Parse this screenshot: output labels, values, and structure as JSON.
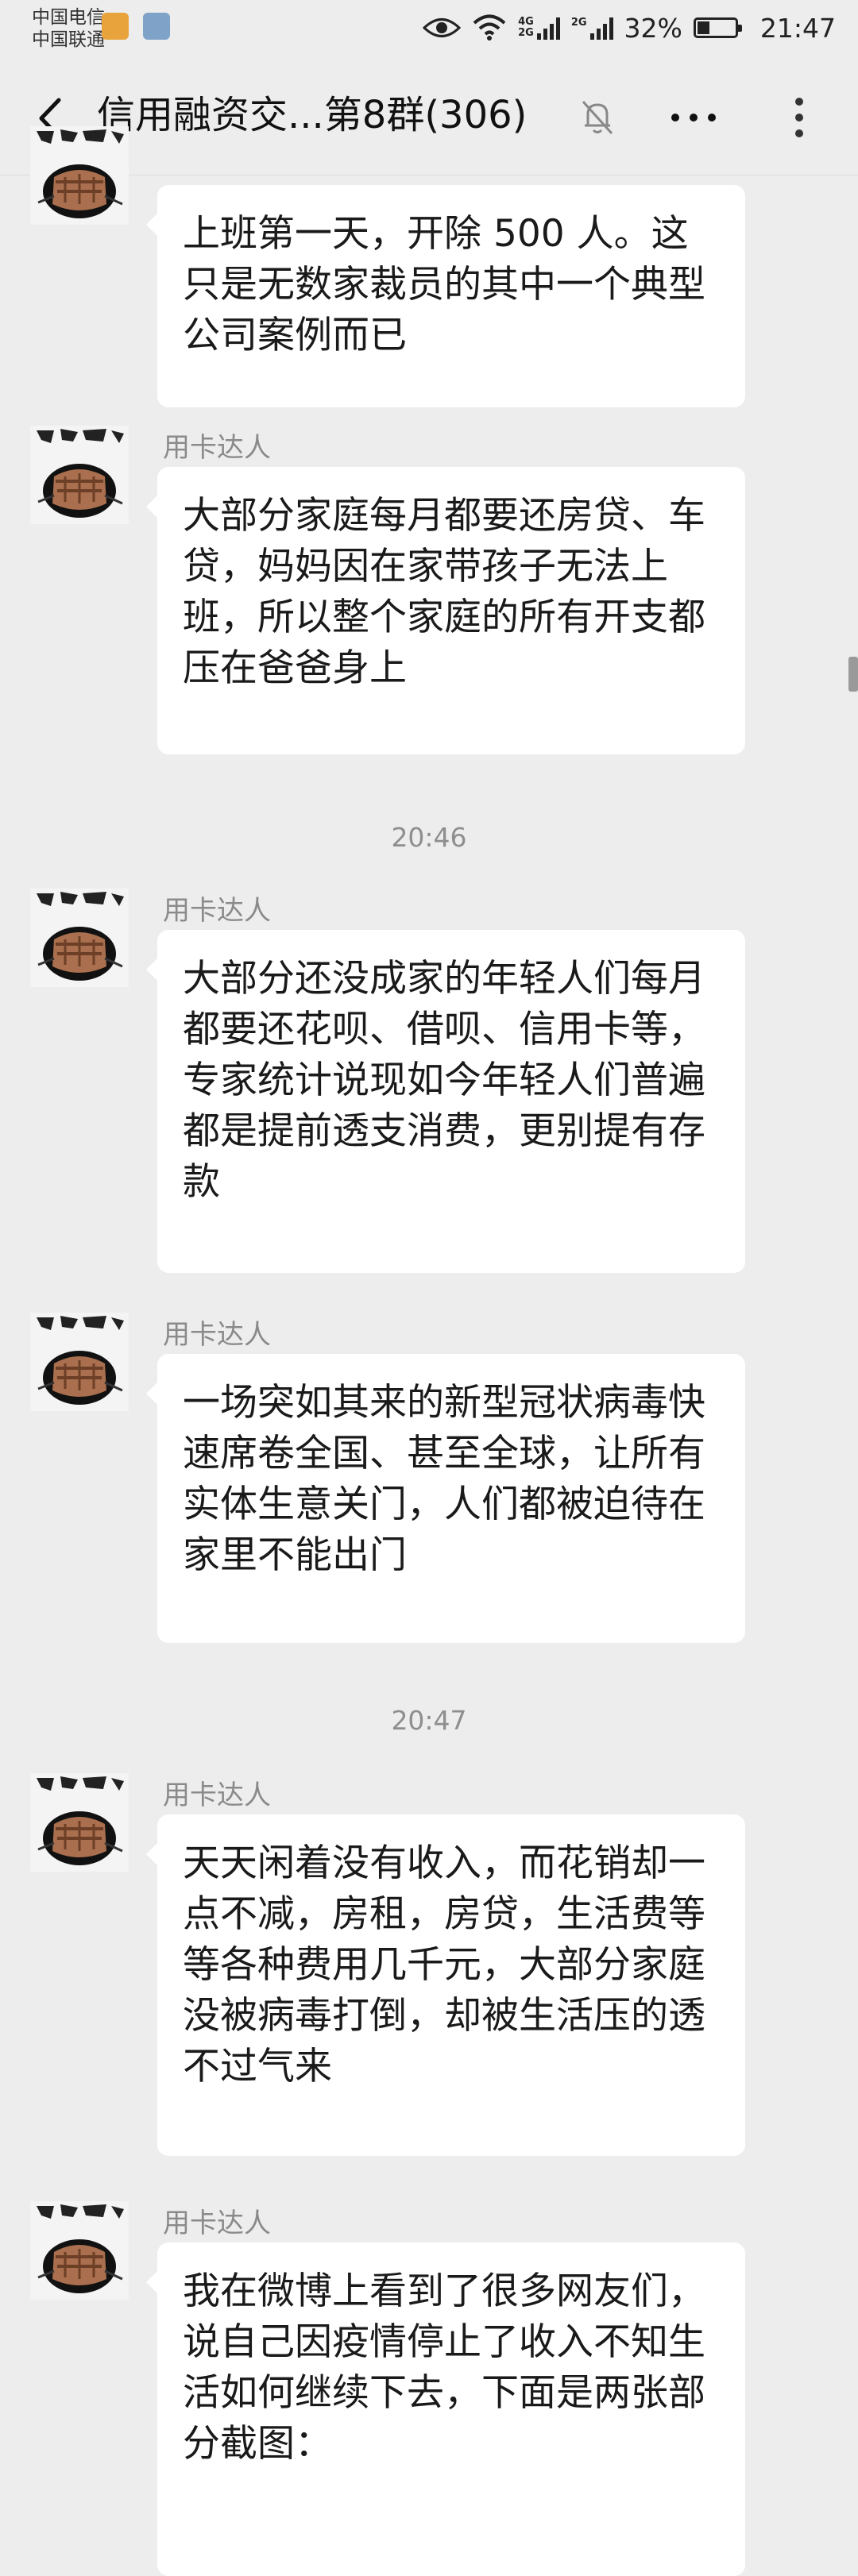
{
  "status_bar": {
    "carrier_1": "中国电信",
    "carrier_2": "中国联通",
    "net_1_top": "4G",
    "net_1_bottom": "2G",
    "net_2": "2G",
    "battery_text": "32%",
    "battery_level": 0.32,
    "time": "21:47"
  },
  "nav": {
    "title": "信用融资交...第8群(306)"
  },
  "colors": {
    "background": "#ededed",
    "bubble": "#ffffff",
    "text": "#1a1a1a",
    "meta_text": "#8a8a8a"
  },
  "messages": [
    {
      "sender": "",
      "text": "上班第一天，开除 500 人。这只是无数家裁员的其中一个典型公司案例而已"
    },
    {
      "sender": "用卡达人",
      "text": "大部分家庭每月都要还房贷、车贷，妈妈因在家带孩子无法上班，所以整个家庭的所有开支都压在爸爸身上"
    },
    {
      "time": "20:46"
    },
    {
      "sender": "用卡达人",
      "text": "大部分还没成家的年轻人们每月都要还花呗、借呗、信用卡等，专家统计说现如今年轻人们普遍都是提前透支消费，更别提有存款"
    },
    {
      "sender": "用卡达人",
      "text": "一场突如其来的新型冠状病毒快速席卷全国、甚至全球，让所有实体生意关门，人们都被迫待在家里不能出门"
    },
    {
      "time": "20:47"
    },
    {
      "sender": "用卡达人",
      "text": "天天闲着没有收入，而花销却一点不减，房租，房贷，生活费等等各种费用几千元，大部分家庭没被病毒打倒，却被生活压的透不过气来"
    },
    {
      "sender": "用卡达人",
      "text": "我在微博上看到了很多网友们，说自己因疫情停止了收入不知生活如何继续下去，下面是两张部分截图："
    }
  ],
  "icons": {
    "back": "chevron-left-icon",
    "mute": "bell-off-icon",
    "more_h": "more-horizontal-icon",
    "more_v": "more-vertical-icon",
    "avatar": "fist-avatar"
  }
}
